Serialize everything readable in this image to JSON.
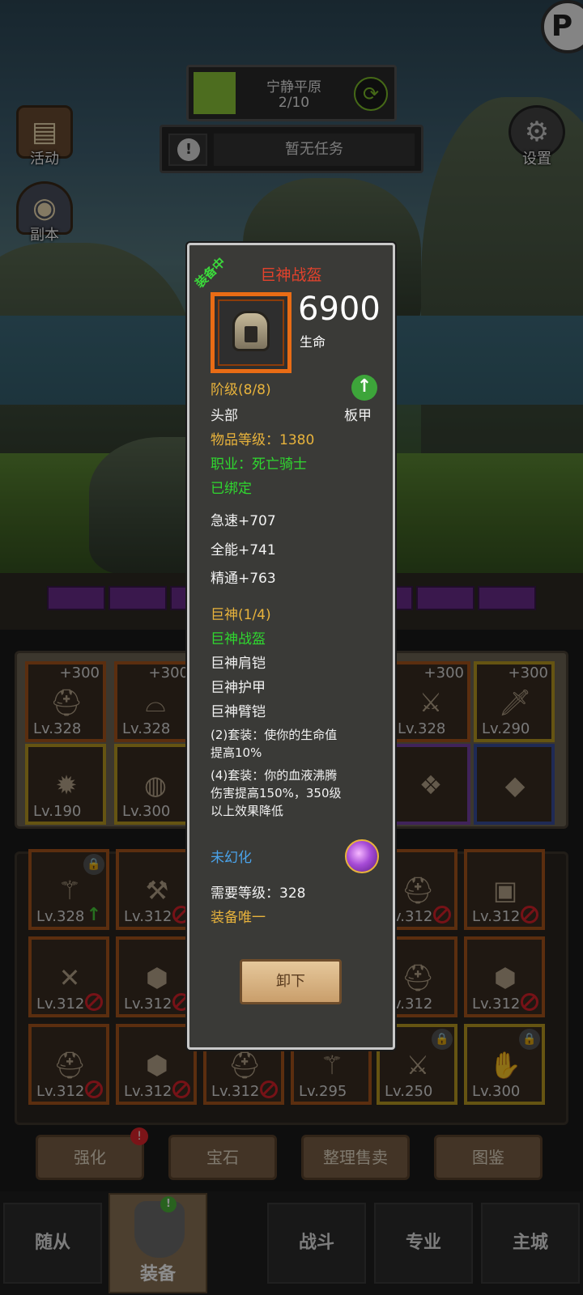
{
  "hud": {
    "corner_badge": "P",
    "zone_name": "宁静平原",
    "zone_progress": "2/10",
    "zone_progress_fraction": 0.2,
    "task_text": "暂无任务",
    "left_buttons": [
      {
        "label": "活动"
      },
      {
        "label": "副本"
      }
    ],
    "settings_label": "设置"
  },
  "equip_slots": [
    {
      "level": "Lv.328",
      "plus": "+300"
    },
    {
      "level": "Lv.328",
      "plus": "+300"
    },
    {
      "level": "Lv.328",
      "plus": "+300"
    },
    {
      "level": "Lv.290",
      "plus": "+300"
    },
    {
      "level": "Lv.190",
      "plus": ""
    },
    {
      "level": "Lv.300",
      "plus": ""
    }
  ],
  "bag_slots": [
    {
      "level": "Lv.328"
    },
    {
      "level": "Lv.312"
    },
    {
      "level": "Lv.312"
    },
    {
      "level": "Lv.312"
    },
    {
      "level": "Lv.312"
    },
    {
      "level": "Lv.312"
    },
    {
      "level": "Lv.312"
    },
    {
      "level": "Lv.312"
    },
    {
      "level": "Lv.312"
    },
    {
      "level": "Lv.312"
    },
    {
      "level": "Lv.312"
    },
    {
      "level": "Lv.295"
    },
    {
      "level": "Lv.250"
    },
    {
      "level": "Lv.300"
    }
  ],
  "action_buttons": [
    {
      "label": "强化"
    },
    {
      "label": "宝石"
    },
    {
      "label": "整理售卖"
    },
    {
      "label": "图鉴"
    }
  ],
  "bottom_nav": [
    {
      "label": "随从"
    },
    {
      "label": "装备"
    },
    {
      "label": "战斗"
    },
    {
      "label": "专业"
    },
    {
      "label": "主城"
    }
  ],
  "tooltip": {
    "equipped_tag": "装备中",
    "item_name": "巨神战盔",
    "stat_value": "6900",
    "stat_name": "生命",
    "tier": "阶级(8/8)",
    "slot": "头部",
    "armor_type": "板甲",
    "item_level": "物品等级：1380",
    "class_req": "职业：死亡骑士",
    "bound": "已绑定",
    "secondary_stats": [
      "急速+707",
      "全能+741",
      "精通+763"
    ],
    "set_title": "巨神(1/4)",
    "set_pieces": [
      {
        "name": "巨神战盔",
        "owned": true
      },
      {
        "name": "巨神肩铠",
        "owned": false
      },
      {
        "name": "巨神护甲",
        "owned": false
      },
      {
        "name": "巨神臂铠",
        "owned": false
      }
    ],
    "set_bonus_2": [
      "(2)套装：使你的生命值",
      "提高10%"
    ],
    "set_bonus_4": [
      "(4)套装：你的血液沸腾",
      "伤害提高150%，350级",
      "以上效果降低"
    ],
    "transmog": "未幻化",
    "required_level": "需要等级：328",
    "unique": "装备唯一",
    "unequip_label": "卸下"
  },
  "colors": {
    "item_name": "#e2422c",
    "gold_text": "#e8b33c",
    "green_text": "#2fd82f",
    "blue_text": "#4aa3ea",
    "legendary_border": "#e96c15"
  }
}
